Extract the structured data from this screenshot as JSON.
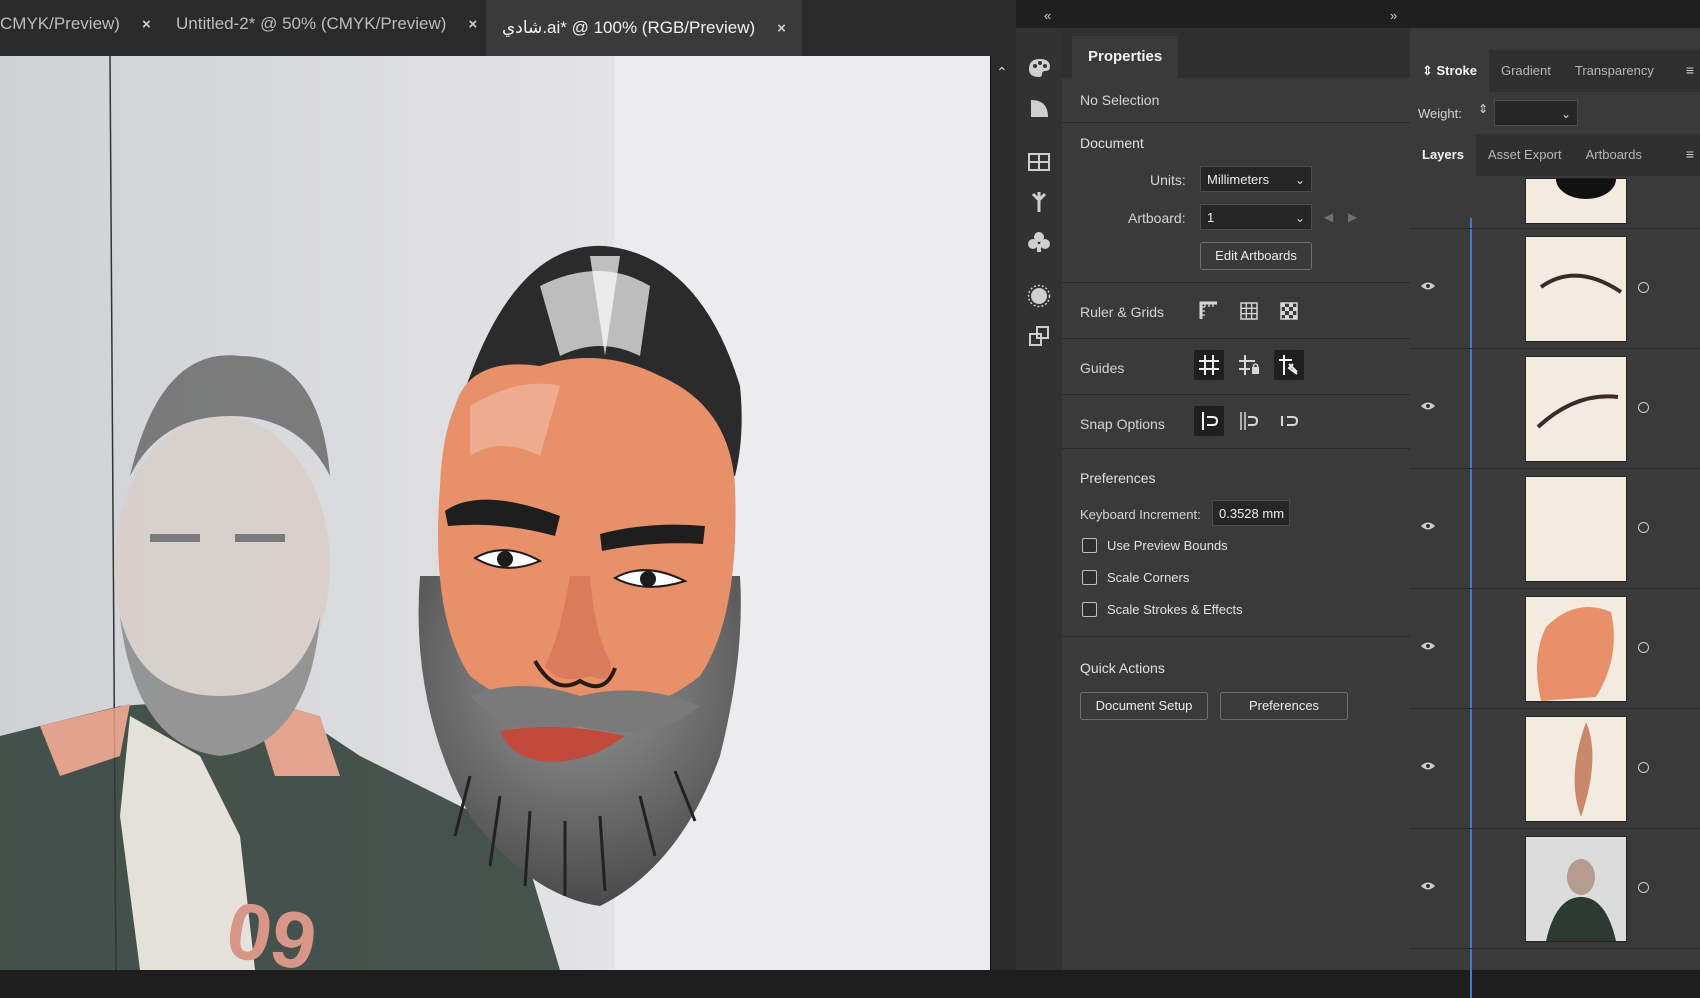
{
  "tabs": [
    {
      "label": "CMYK/Preview)",
      "close": "×",
      "active": false
    },
    {
      "label": "Untitled-2* @ 50% (CMYK/Preview)",
      "close": "×",
      "active": false
    },
    {
      "label": "شادي.ai* @ 100% (RGB/Preview)",
      "close": "×",
      "active": true
    }
  ],
  "properties": {
    "tab_label": "Properties",
    "selection": "No Selection",
    "document_title": "Document",
    "units_label": "Units:",
    "units_value": "Millimeters",
    "artboard_label": "Artboard:",
    "artboard_value": "1",
    "edit_artboards": "Edit Artboards",
    "ruler_grids": "Ruler & Grids",
    "guides": "Guides",
    "snap_options": "Snap Options",
    "preferences_title": "Preferences",
    "keyboard_increment_label": "Keyboard Increment:",
    "keyboard_increment_value": "0.3528 mm",
    "use_preview_bounds": "Use Preview Bounds",
    "scale_corners": "Scale Corners",
    "scale_strokes_effects": "Scale Strokes & Effects",
    "quick_actions": "Quick Actions",
    "document_setup": "Document Setup",
    "preferences_button": "Preferences"
  },
  "stroke_panel": {
    "tabs": [
      "Stroke",
      "Gradient",
      "Transparency"
    ],
    "weight_label": "Weight:"
  },
  "layers_panel": {
    "tabs": [
      "Layers",
      "Asset Export",
      "Artboards"
    ]
  },
  "colors": {
    "skin": "#e8906a",
    "beard": "#6e6e6e",
    "hair": "#2b2b2b",
    "accent_blue": "#3c7bd9"
  }
}
